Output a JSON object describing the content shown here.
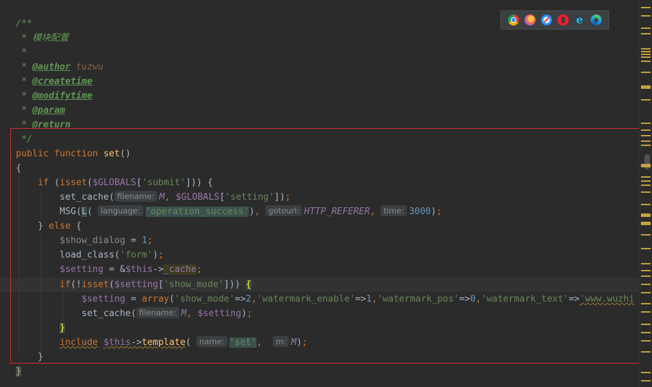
{
  "editor": {
    "comment": {
      "open": "/**",
      "desc": " * 模块配置",
      "star": " *",
      "author_tag": "@author",
      "author_val": "tuzwu",
      "createtime_tag": "@createtime",
      "modifytime_tag": "@modifytime",
      "param_tag": "@param",
      "return_tag": "@return",
      "close": " */"
    },
    "code": {
      "kw_public": "public",
      "kw_function": "function",
      "fn_set": "set",
      "lbrace": "{",
      "rbrace": "}",
      "kw_if": "if",
      "fn_isset": "isset",
      "var_globals": "$GLOBALS",
      "str_submit": "'submit'",
      "fn_set_cache": "set_cache",
      "hint_filename": "filename:",
      "const_m": "M",
      "str_setting": "'setting'",
      "fn_msg": "MSG",
      "fn_l": "L",
      "hint_language": "language:",
      "str_operation_success": "'operation_success'",
      "hint_gotourl": "gotourl:",
      "const_http_referer": "HTTP_REFERER",
      "hint_time": "time:",
      "num_3000": "3000",
      "kw_else": "else",
      "var_show_dialog": "$show_dialog",
      "num_1": "1",
      "fn_load_class": "load_class",
      "str_form": "'form'",
      "var_setting": "$setting",
      "var_this": "$this",
      "prop_cache": "_cache",
      "str_show_mode": "'show_mode'",
      "fn_array": "array",
      "num_2": "2",
      "str_watermark_enable": "'watermark_enable'",
      "str_watermark_pos": "'watermark_pos'",
      "num_0": "0",
      "str_watermark_text": "'watermark_text'",
      "str_www": "'www.wuzhi",
      "kw_include": "include",
      "fn_template": "template",
      "hint_name": "name:",
      "str_set": "'set'",
      "hint_m": "m:"
    }
  },
  "browser_bar": {
    "icons": [
      "chrome-icon",
      "firefox-icon",
      "safari-icon",
      "opera-icon",
      "ie-icon",
      "edge-icon"
    ]
  },
  "colors": {
    "background": "#2b2b2b",
    "keyword": "#cc7832",
    "function": "#ffc66d",
    "variable": "#9876aa",
    "string": "#6a8759",
    "number": "#6897bb",
    "comment": "#629755",
    "selection_border": "#d32f2f",
    "marker": "#c7a33c"
  }
}
